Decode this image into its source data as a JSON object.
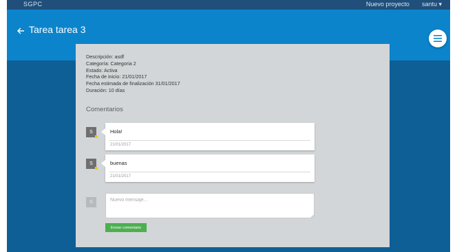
{
  "topnav": {
    "brand": "SGPC",
    "links": [
      "Nuevo proyecto",
      "santu ▾"
    ]
  },
  "header": {
    "back_icon": "arrow-left-icon",
    "title": "Tarea tarea 3",
    "menu_icon": "hamburger-menu-icon"
  },
  "task": {
    "description": "Descripción: asdf",
    "category": "Categoría: Categoria 2",
    "status": "Estado: Activa",
    "start_date": "Fecha de inicio: 21/01/2017",
    "end_date": "Fecha estimada de finalización 31/01/2017",
    "duration": "Duración: 10 días"
  },
  "comments": {
    "title": "Comentarios",
    "items": [
      {
        "avatar": "S",
        "text": "Hola!",
        "date": "21/01/2017"
      },
      {
        "avatar": "S",
        "text": "buenas",
        "date": "21/01/2017"
      }
    ]
  },
  "new_comment": {
    "avatar": "S",
    "placeholder": "Nuevo mensaje...",
    "value": "",
    "submit_label": "Enviar comentario"
  },
  "colors": {
    "topnav": "#1f4f7a",
    "appbar": "#0b84cc",
    "content_bg": "#0f5f97",
    "card": "#d3d6d8",
    "submit": "#4caf50",
    "avatar_badge": "#f4c418"
  }
}
